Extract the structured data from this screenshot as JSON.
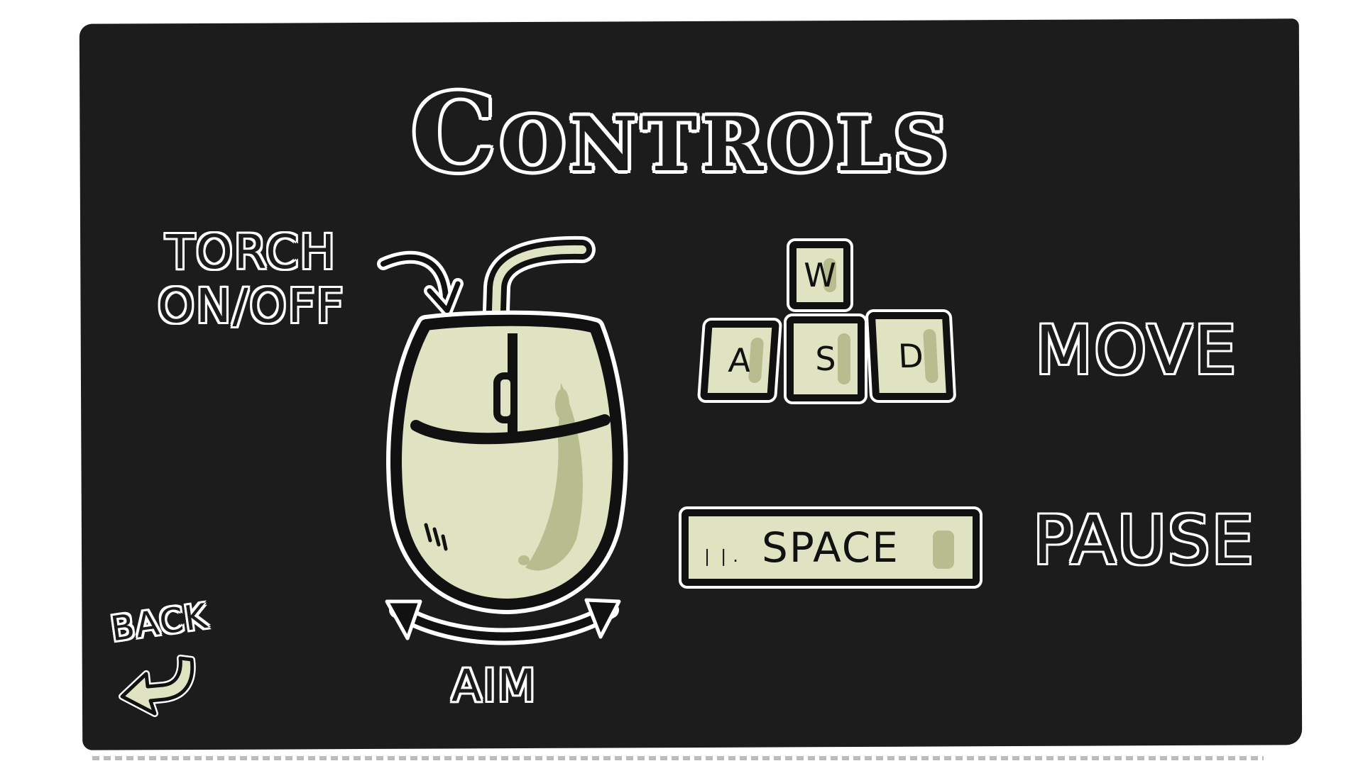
{
  "screen": {
    "title": "Controls",
    "background_color": "#1c1c1c",
    "accent_color": "#dfe3c2"
  },
  "mouse": {
    "torch_label_line1": "TORCH",
    "torch_label_line2": "ON/OFF",
    "aim_label": "AIM",
    "icon": "mouse-icon"
  },
  "keys": {
    "w": "W",
    "a": "A",
    "s": "S",
    "d": "D",
    "space": "SPACE",
    "move_label": "MOVE",
    "pause_label": "PAUSE"
  },
  "back": {
    "label": "BACK",
    "icon": "back-arrow-icon"
  }
}
